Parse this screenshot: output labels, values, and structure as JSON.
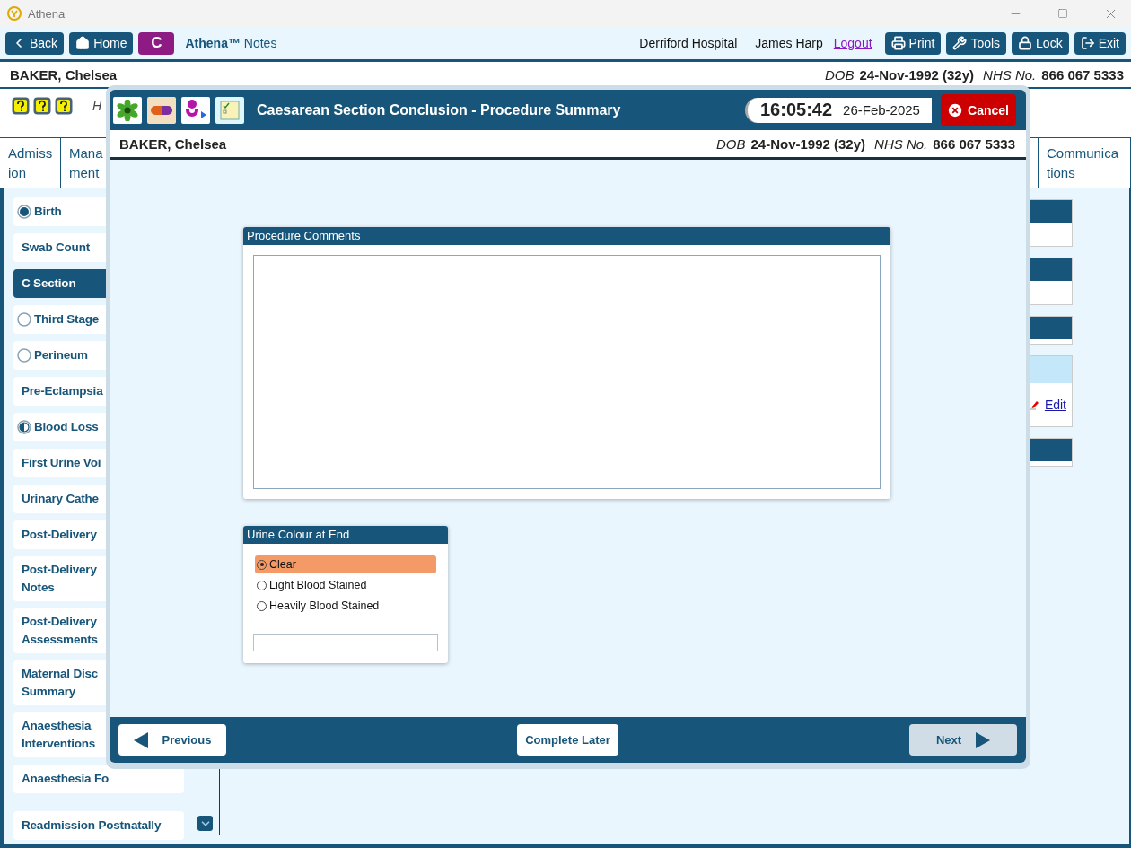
{
  "window": {
    "title": "Athena"
  },
  "toolbar": {
    "left_buttons": [
      {
        "kind": "back",
        "label": "Back"
      },
      {
        "kind": "home",
        "label": "Home"
      }
    ],
    "app_badge": "C",
    "app_name": "**Athena™** Notes",
    "hospital": "Derriford Hospital",
    "user": "James Harp",
    "logout": "Logout",
    "right_buttons": [
      {
        "kind": "print",
        "label": "Print"
      },
      {
        "kind": "tools",
        "label": "Tools"
      },
      {
        "kind": "lock",
        "label": "Lock"
      },
      {
        "kind": "exit",
        "label": "Exit"
      }
    ]
  },
  "patient": {
    "name": "BAKER, Chelsea",
    "dob_label": "DOB",
    "dob": "24-Nov-1992 (32y)",
    "nhs_label": "NHS No.",
    "nhs": "866 067 5333"
  },
  "info_row": {
    "text": "H"
  },
  "tabs": [
    {
      "label": "Admiss\nion"
    },
    {
      "label": "Mana\nment"
    },
    {
      "label": "Communica\ntions"
    }
  ],
  "sidebar": {
    "items": [
      {
        "kind": "complete",
        "label": "Birth",
        "selected": false
      },
      {
        "kind": "plain",
        "label": "Swab Count",
        "selected": false
      },
      {
        "kind": "plain",
        "label": "C Section",
        "selected": true
      },
      {
        "kind": "empty",
        "label": "Third Stage",
        "selected": false
      },
      {
        "kind": "empty",
        "label": "Perineum",
        "selected": false
      },
      {
        "kind": "plain",
        "label": "Pre-Eclampsia",
        "selected": false
      },
      {
        "kind": "partial",
        "label": "Blood Loss",
        "selected": false
      },
      {
        "kind": "plain",
        "label": "First Urine Voi",
        "selected": false
      },
      {
        "kind": "plain",
        "label": "Urinary Cathe",
        "selected": false
      },
      {
        "kind": "plain",
        "label": "Post-Delivery",
        "selected": false
      },
      {
        "kind": "plain",
        "label": "Post-Delivery\nNotes",
        "selected": false
      },
      {
        "kind": "plain",
        "label": "Post-Delivery\nAssessments",
        "selected": false
      },
      {
        "kind": "plain",
        "label": "Maternal Disc\nSummary",
        "selected": false
      },
      {
        "kind": "plain",
        "label": "Anaesthesia\nInterventions",
        "selected": false
      },
      {
        "kind": "plain",
        "label": "Anaesthesia Fo",
        "selected": false
      },
      {
        "kind": "plain",
        "label": "Readmission Postnatally",
        "selected": false
      }
    ]
  },
  "right_panels": [
    {
      "kind": "tall"
    },
    {
      "kind": "tall"
    },
    {
      "kind": "slim"
    },
    {
      "kind": "link",
      "link": "Edit"
    },
    {
      "kind": "slim"
    }
  ],
  "dialog": {
    "title": "Caesarean Section Conclusion - Procedure Summary",
    "time": "16:05:42",
    "date": "26-Feb-2025",
    "cancel": "Cancel",
    "patient": {
      "name": "BAKER, Chelsea",
      "dob_label": "DOB",
      "dob": "24-Nov-1992 (32y)",
      "nhs_label": "NHS No.",
      "nhs": "866 067 5333"
    },
    "procedure_comments": {
      "title": "Procedure Comments"
    },
    "urine_colour": {
      "title": "Urine Colour at End",
      "options": [
        {
          "label": "Clear",
          "selected": true
        },
        {
          "label": "Light Blood Stained",
          "selected": false
        },
        {
          "label": "Heavily Blood Stained",
          "selected": false
        }
      ]
    },
    "footer": {
      "previous": "Previous",
      "complete_later": "Complete Later",
      "next": "Next",
      "next_disabled": true
    }
  }
}
